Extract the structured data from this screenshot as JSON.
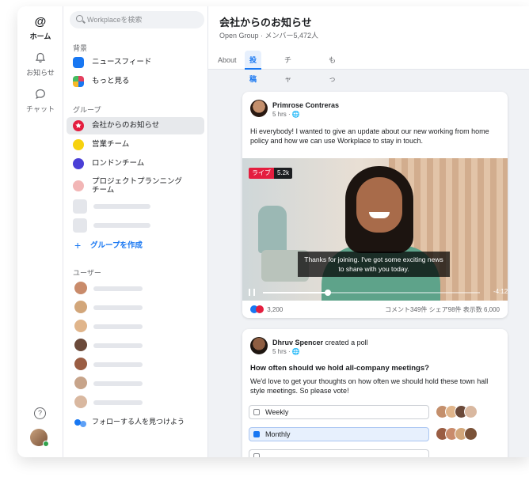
{
  "rail": {
    "home_label": "ホーム",
    "notifications_label": "お知らせ",
    "chat_label": "チャット",
    "help_icon": "question-icon"
  },
  "sidebar": {
    "search_placeholder": "Workplaceを検索",
    "home_section": "背景",
    "home_items": [
      {
        "label": "ニュースフィード",
        "icon": "news-feed-icon",
        "color": "#1877f2"
      },
      {
        "label": "もっと見る",
        "icon": "grid-icon",
        "color": "#e4405f"
      }
    ],
    "groups_section": "グループ",
    "groups": [
      {
        "label": "会社からのお知らせ",
        "color": "#e41e3f"
      },
      {
        "label": "営業チーム",
        "color": "#f7d20e"
      },
      {
        "label": "ロンドンチーム",
        "color": "#4a3fd6"
      },
      {
        "label": "プロジェクトプランニングチーム",
        "color": "#f2b6b6"
      }
    ],
    "create_group": "グループを作成",
    "users_section": "ユーザー",
    "find_people": "フォローする人を見つけよう"
  },
  "header": {
    "title": "会社からのお知らせ",
    "subtitle": "Open Group · メンバー5,472人",
    "tabs": [
      "About",
      "投稿",
      "チャット",
      "もっと見る"
    ],
    "active_tab": "投稿"
  },
  "post1": {
    "author": "Primrose Contreras",
    "meta": "5 hrs · 🌐",
    "text": "Hi everybody! I wanted to give an update about our new working from home policy and how we can use Workplace to stay in touch.",
    "live_label": "ライブ",
    "viewer_count": "5.2k",
    "caption": "Thanks for joining. I've got some exciting news to share with you today.",
    "progress": 0.3,
    "time_left": "-4:12",
    "reactions": "3,200",
    "stats_right": "コメント349件 シェア98件 表示数 6,000"
  },
  "post2": {
    "author": "Dhruv Spencer",
    "verb": "created a poll",
    "meta": "5 hrs · 🌐",
    "question": "How often should we hold all-company meetings?",
    "text": "We'd love to get your thoughts on how often we should hold these town hall style meetings. So please vote!",
    "options": [
      {
        "label": "Weekly",
        "selected": false
      },
      {
        "label": "Monthly",
        "selected": true
      }
    ]
  },
  "colors": {
    "accent": "#1877f2",
    "live": "#e41e3f",
    "online": "#31a24c"
  }
}
